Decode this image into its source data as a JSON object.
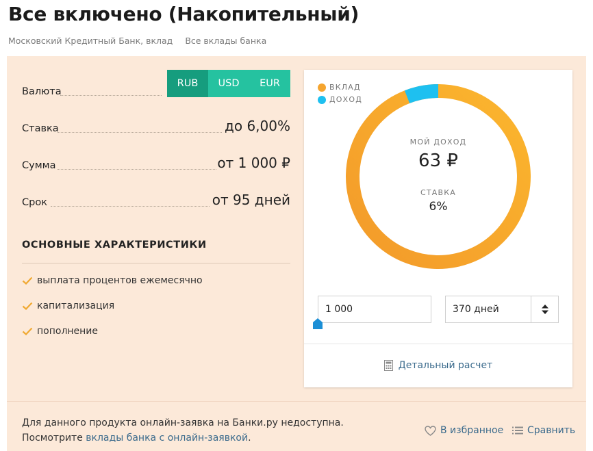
{
  "header": {
    "title": "Все включено (Накопительный)",
    "breadcrumb": [
      "Московский Кредитный Банк, вклад",
      "Все вклады банка"
    ]
  },
  "params": {
    "currency_label": "Валюта",
    "currencies": [
      "RUB",
      "USD",
      "EUR"
    ],
    "selected_currency": "RUB",
    "rate_label": "Ставка",
    "rate_value": "до 6,00%",
    "sum_label": "Сумма",
    "sum_value": "от 1 000 ₽",
    "term_label": "Срок",
    "term_value": "от 95 дней"
  },
  "features": {
    "title": "ОСНОВНЫЕ ХАРАКТЕРИСТИКИ",
    "items": [
      "выплата процентов ежемесячно",
      "капитализация",
      "пополнение"
    ]
  },
  "calculator": {
    "legend": [
      {
        "label": "ВКЛАД",
        "color": "#f5a530"
      },
      {
        "label": "ДОХОД",
        "color": "#1ec0f0"
      }
    ],
    "income_label": "МОЙ ДОХОД",
    "income_value": "63 ₽",
    "rate_label": "СТАВКА",
    "rate_value": "6%",
    "amount_input": "1 000",
    "term_input": "370 дней",
    "details_link": "Детальный расчет",
    "donut": {
      "deposit": 1000,
      "income": 63
    }
  },
  "footer": {
    "note_line1": "Для данного продукта онлайн-заявка на Банки.ру недоступна.",
    "note_prefix": "Посмотрите ",
    "note_link": "вклады банка с онлайн-заявкой",
    "note_suffix": ".",
    "favorite": "В избранное",
    "compare": "Сравнить"
  },
  "colors": {
    "accent_green": "#25c2a0",
    "accent_green_dark": "#169d7e",
    "panel_bg": "#fce9d9",
    "link": "#3a6a8c",
    "deposit": "#f5a530",
    "income": "#1ec0f0"
  }
}
